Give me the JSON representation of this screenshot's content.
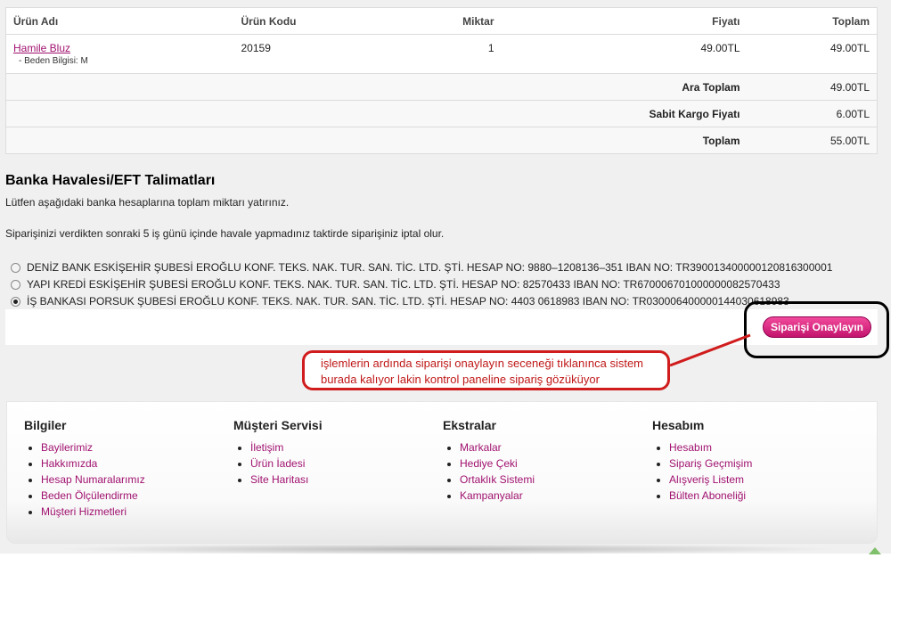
{
  "cart": {
    "headers": [
      "Ürün Adı",
      "Ürün Kodu",
      "Miktar",
      "Fiyatı",
      "Toplam"
    ],
    "items": [
      {
        "name": "Hamile Bluz",
        "option": "- Beden Bilgisi: M",
        "code": "20159",
        "qty": "1",
        "price": "49.00TL",
        "total": "49.00TL"
      }
    ],
    "totals": [
      {
        "label": "Ara Toplam",
        "value": "49.00TL"
      },
      {
        "label": "Sabit Kargo Fiyatı",
        "value": "6.00TL"
      },
      {
        "label": "Toplam",
        "value": "55.00TL"
      }
    ]
  },
  "bank": {
    "title": "Banka Havalesi/EFT Talimatları",
    "instruction": "Lütfen aşağıdaki banka hesaplarına toplam miktarı yatırınız.",
    "warning": "Siparişinizi verdikten sonraki 5 iş günü içinde havale yapmadınız taktirde siparişiniz iptal olur.",
    "options": [
      {
        "label": "DENİZ BANK ESKİŞEHİR ŞUBESİ EROĞLU KONF. TEKS. NAK. TUR. SAN. TİC. LTD. ŞTİ. HESAP NO: 9880–1208136–351 IBAN NO: TR390013400000120816300001",
        "selected": false
      },
      {
        "label": "YAPI KREDİ ESKİŞEHİR ŞUBESİ EROĞLU KONF. TEKS. NAK. TUR. SAN. TİC. LTD. ŞTİ. HESAP NO: 82570433 IBAN NO: TR670006701000000082570433",
        "selected": false
      },
      {
        "label": "İŞ BANKASI PORSUK ŞUBESİ EROĞLU KONF. TEKS. NAK. TUR. SAN. TİC. LTD. ŞTİ. HESAP NO: 4403 0618983 IBAN NO: TR030006400000144030618983",
        "selected": true
      }
    ],
    "confirm_label": "Siparişi Onaylayın"
  },
  "annotation": {
    "line1": "işlemlerin ardında siparişi onaylayın seceneği tıklanınca sistem",
    "line2": "burada kalıyor lakin kontrol paneline sipariş gözüküyor",
    "color": "#d01c1c"
  },
  "footer": {
    "columns": [
      {
        "title": "Bilgiler",
        "links": [
          "Bayilerimiz",
          "Hakkımızda",
          "Hesap Numaralarımız",
          "Beden Ölçülendirme",
          "Müşteri Hizmetleri"
        ]
      },
      {
        "title": "Müşteri Servisi",
        "links": [
          "İletişim",
          "Ürün İadesi",
          "Site Haritası"
        ]
      },
      {
        "title": "Ekstralar",
        "links": [
          "Markalar",
          "Hediye Çeki",
          "Ortaklık Sistemi",
          "Kampanyalar"
        ]
      },
      {
        "title": "Hesabım",
        "links": [
          "Hesabım",
          "Sipariş Geçmişim",
          "Alışveriş Listem",
          "Bülten Aboneliği"
        ]
      }
    ]
  },
  "colors": {
    "brand_link": "#a0116f",
    "button": "#d21d7b"
  }
}
